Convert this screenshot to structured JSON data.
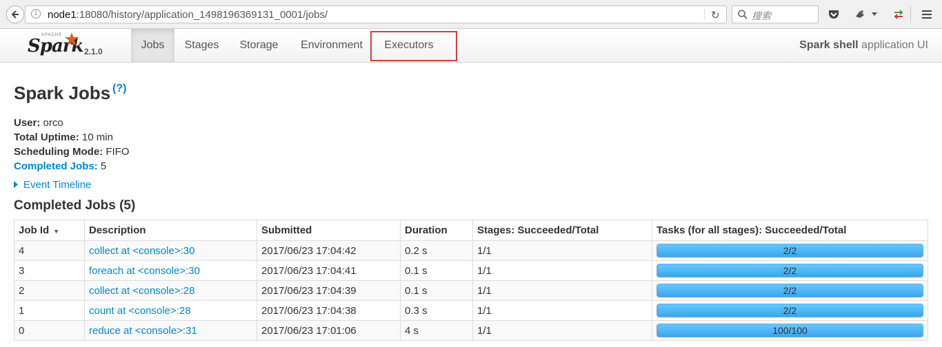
{
  "browser": {
    "url_host": "node1",
    "url_rest": ":18080/history/application_1498196369131_0001/jobs/",
    "search_placeholder": "搜索"
  },
  "navbar": {
    "brand_apache": "APACHE",
    "brand_spark": "Spark",
    "version": "2.1.0",
    "tabs": [
      {
        "label": "Jobs",
        "active": true
      },
      {
        "label": "Stages",
        "active": false
      },
      {
        "label": "Storage",
        "active": false
      },
      {
        "label": "Environment",
        "active": false
      },
      {
        "label": "Executors",
        "active": false
      }
    ],
    "app_title_bold": "Spark shell",
    "app_title_rest": " application UI"
  },
  "page": {
    "title": "Spark Jobs",
    "help": "(?)",
    "user_label": "User:",
    "user": "orco",
    "uptime_label": "Total Uptime:",
    "uptime": "10 min",
    "sched_label": "Scheduling Mode:",
    "sched": "FIFO",
    "completed_label": "Completed Jobs:",
    "completed": "5",
    "timeline": "Event Timeline",
    "section_title": "Completed Jobs (5)"
  },
  "table": {
    "headers": [
      "Job Id",
      "Description",
      "Submitted",
      "Duration",
      "Stages: Succeeded/Total",
      "Tasks (for all stages): Succeeded/Total"
    ],
    "sort_indicator": "▼",
    "rows": [
      {
        "id": "4",
        "desc": "collect at <console>:30",
        "submitted": "2017/06/23 17:04:42",
        "duration": "0.2 s",
        "stages": "1/1",
        "tasks": "2/2",
        "progress": 1.0
      },
      {
        "id": "3",
        "desc": "foreach at <console>:30",
        "submitted": "2017/06/23 17:04:41",
        "duration": "0.1 s",
        "stages": "1/1",
        "tasks": "2/2",
        "progress": 1.0
      },
      {
        "id": "2",
        "desc": "collect at <console>:28",
        "submitted": "2017/06/23 17:04:39",
        "duration": "0.1 s",
        "stages": "1/1",
        "tasks": "2/2",
        "progress": 1.0
      },
      {
        "id": "1",
        "desc": "count at <console>:28",
        "submitted": "2017/06/23 17:04:38",
        "duration": "0.3 s",
        "stages": "1/1",
        "tasks": "2/2",
        "progress": 1.0
      },
      {
        "id": "0",
        "desc": "reduce at <console>:31",
        "submitted": "2017/06/23 17:01:06",
        "duration": "4 s",
        "stages": "1/1",
        "tasks": "100/100",
        "progress": 1.0
      }
    ]
  },
  "colors": {
    "link": "#0088cc",
    "highlight": "#d43f3a",
    "progress": "#3aa6ee"
  }
}
